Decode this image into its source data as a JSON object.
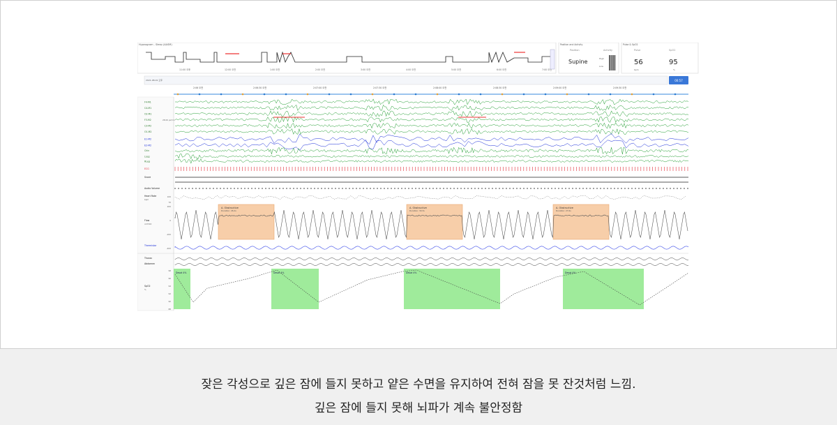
{
  "hypnogram": {
    "title": "Hypnogram - Sleep (AASM)",
    "times": [
      "11:00 오후",
      "12:00 오전",
      "1:00 오전",
      "2:00 오전",
      "3:00 오전",
      "4:00 오전",
      "5:00 오전",
      "6:00 오전",
      "7:00 오전"
    ]
  },
  "position_panel": {
    "title": "Position and Activity",
    "position_label": "Position",
    "position_value": "Supine",
    "activity_label": "Activity",
    "activity_high": "High",
    "activity_low": "Low"
  },
  "pulse_panel": {
    "title": "Pulse & SpO2",
    "pulse_label": "Pulse",
    "pulse_value": "56",
    "pulse_unit": "bpm",
    "spo2_label": "SpO2",
    "spo2_value": "95",
    "spo2_unit": "%"
  },
  "timeline": {
    "date": "2021-08-01 오후",
    "ticks": [
      "2:06 오전",
      "2:06:30 오전",
      "2:07:00 오전",
      "2:07:30 오전",
      "2:08:00 오전",
      "2:08:30 오전",
      "2:09:00 오전",
      "2:09:30 오전"
    ],
    "button_label": "00:57"
  },
  "channels": {
    "eeg": [
      "F4-M1",
      "C4-M1",
      "O2-M1",
      "F3-M2",
      "C3-M2",
      "O1-M2"
    ],
    "eeg_scale": "28.00 µV/cm",
    "eog": [
      "E1-M2",
      "E2-M2"
    ],
    "chin": "Chin",
    "leg": [
      "LLeg",
      "RLeg"
    ],
    "ecg": "ECG",
    "snore": "Snore",
    "audio": "Audio Volume",
    "heart_rate": "Heart Rate",
    "heart_rate_unit": "bpm",
    "flow": "Flow",
    "flow_unit": "cmH2O",
    "thermistor": "Thermistor",
    "thorax": "Thorax",
    "abdomen": "Abdomen",
    "spo2": "SpO2",
    "spo2_unit": "%",
    "hr_ticks": [
      "100",
      "70"
    ],
    "flow_ticks": [
      "200",
      "0",
      "-200",
      "-400"
    ],
    "spo2_ticks": [
      "98",
      "96",
      "94",
      "92",
      "90",
      "88"
    ]
  },
  "events": [
    {
      "label": "A. Obstructive",
      "detail": "Duration: 26.2s"
    },
    {
      "label": "A. Obstructive",
      "detail": "Duration: 30.3s"
    },
    {
      "label": "A. Obstructive",
      "detail": "Duration: 27.6s"
    }
  ],
  "desats": [
    {
      "label": "Desat 4%"
    },
    {
      "label": "Desat 4%"
    },
    {
      "label": "Desat 4%"
    },
    {
      "label": "Desat 4%"
    }
  ],
  "colors": {
    "eeg": "#1a9a2a",
    "eog": "#1428d8",
    "ecg": "#e0303a",
    "event_fill": "#f7c9a0",
    "desat_fill": "#8ee88a"
  },
  "caption": {
    "line1": "잦은 각성으로 깊은 잠에 들지 못하고 얕은 수면을 유지하여 전혀 잠을 못 잔것처럼 느낌.",
    "line2": "깊은 잠에 들지 못해 뇌파가 계속 불안정함"
  }
}
